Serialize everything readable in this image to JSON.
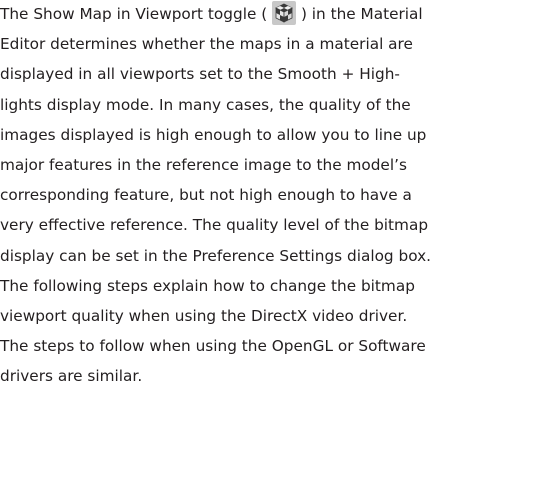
{
  "paragraph": {
    "line_1_before_icon": "The Show Map in Viewport toggle (",
    "line_1_after_icon": ") in the Material",
    "icon": "show-map-in-viewport-checker-cube-icon",
    "lines": [
      "Editor determines whether the maps in a material are",
      "displayed in all viewports set to the Smooth + High-",
      "lights display mode. In many cases, the quality of the",
      "images displayed is high enough to allow you to line up",
      "major features in the reference image to the model’s",
      "corresponding feature, but not high enough to have a",
      "very effective reference. The quality level of the bitmap",
      "display can be set in the Preference Settings dialog box.",
      "The following steps explain how to change the bitmap",
      "viewport quality when using the DirectX video driver.",
      "The steps to follow when using the OpenGL or Software",
      "drivers are similar."
    ]
  },
  "colors": {
    "text": "#231f20",
    "icon_background": "#c8c8c8",
    "icon_dark": "#3a3a3a",
    "icon_light": "#f2f2f2"
  }
}
